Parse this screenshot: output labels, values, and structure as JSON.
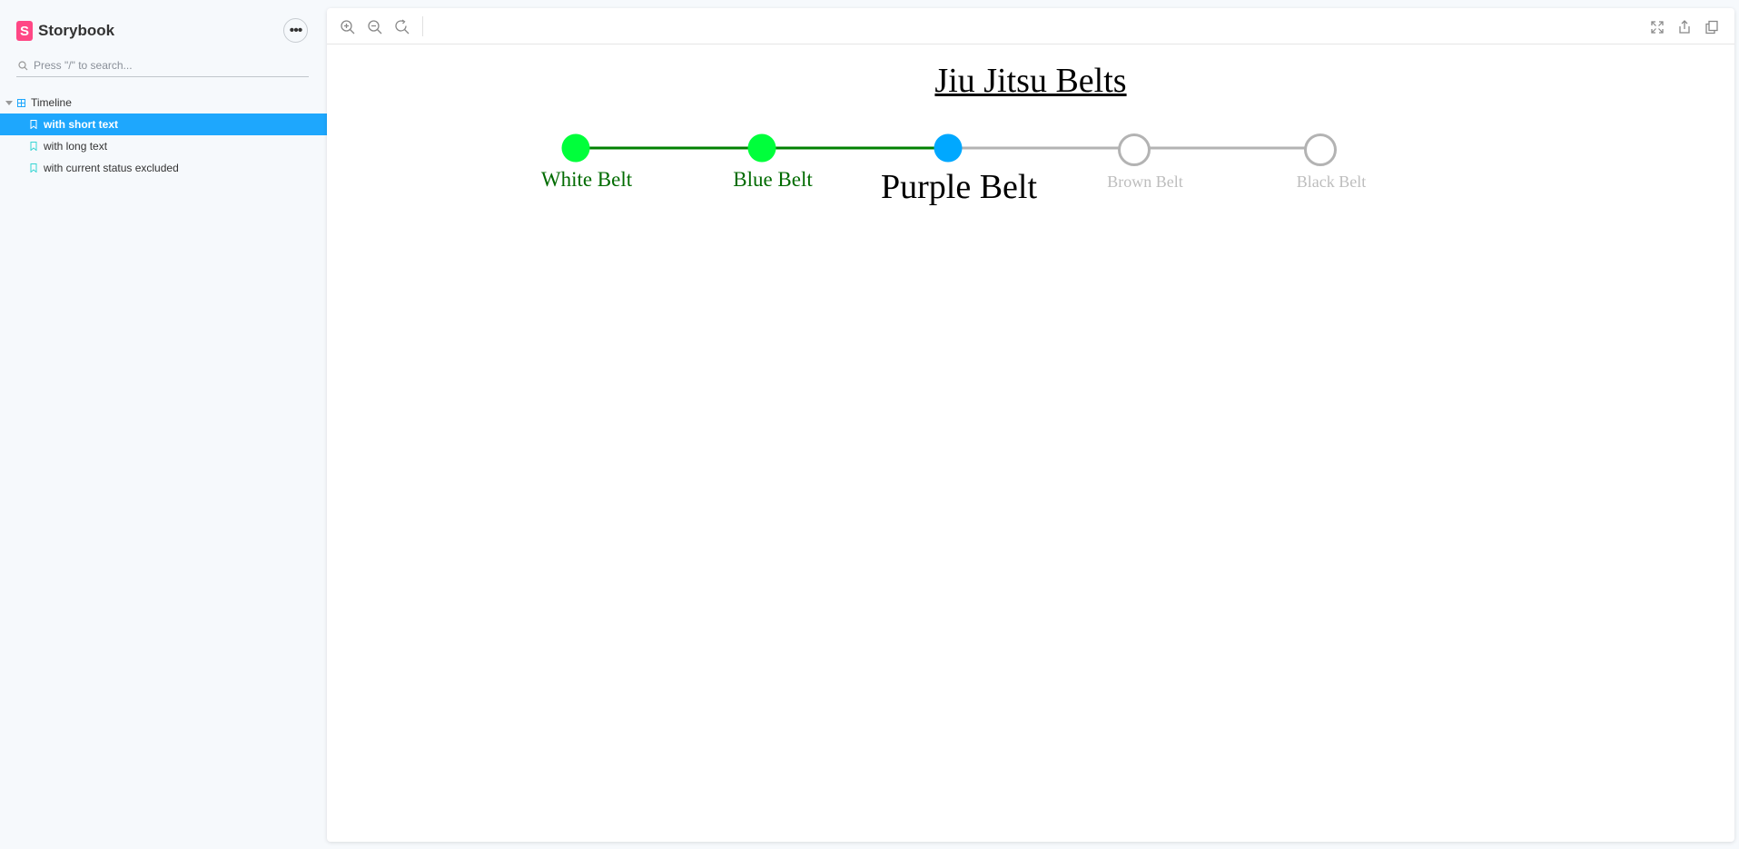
{
  "app": {
    "brand": "Storybook",
    "brand_logo_letter": "S"
  },
  "sidebar": {
    "search_placeholder": "Press \"/\" to search...",
    "tree": {
      "component": "Timeline",
      "stories": [
        {
          "label": "with short text",
          "selected": true
        },
        {
          "label": "with long text",
          "selected": false
        },
        {
          "label": "with current status excluded",
          "selected": false
        }
      ]
    }
  },
  "toolbar": {
    "left_icons": [
      "zoom-in-icon",
      "zoom-out-icon",
      "reset-zoom-icon"
    ],
    "right_icons": [
      "fullscreen-icon",
      "share-icon",
      "copy-icon"
    ]
  },
  "preview": {
    "title": "Jiu Jitsu Belts",
    "belts": [
      {
        "label": "White Belt",
        "status": "complete"
      },
      {
        "label": "Blue Belt",
        "status": "complete"
      },
      {
        "label": "Purple Belt",
        "status": "current"
      },
      {
        "label": "Brown Belt",
        "status": "upcoming"
      },
      {
        "label": "Black Belt",
        "status": "upcoming"
      }
    ],
    "colors": {
      "complete_fill": "#00ff3b",
      "complete_line": "#008000",
      "complete_text": "#006b00",
      "current_fill": "#00a8ff",
      "current_text": "#000000",
      "upcoming_stroke": "#b3b3b3",
      "upcoming_text": "#bdbdbd"
    }
  },
  "accent": "#1ea7fd",
  "brand_color": "#ff4785"
}
